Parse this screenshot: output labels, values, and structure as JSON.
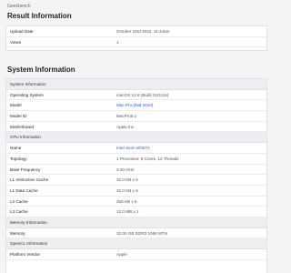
{
  "breadcrumb": "Geekbench",
  "result": {
    "title": "Result Information",
    "rows": [
      {
        "key": "Upload Date",
        "value": "October 23rd 2022, 11:44am"
      },
      {
        "key": "Views",
        "value": "1"
      }
    ]
  },
  "system": {
    "title": "System Information",
    "sections": [
      {
        "header": "System Information",
        "rows": [
          {
            "key": "Operating System",
            "value": "macOS 12.6 (Build 21G115)"
          },
          {
            "key": "Model",
            "value": "Mac Pro (Mid 2010)",
            "link": true
          },
          {
            "key": "Model ID",
            "value": "MacPro5,1"
          },
          {
            "key": "Motherboard",
            "value": "Apple Inc."
          }
        ]
      },
      {
        "header": "CPU Information",
        "rows": [
          {
            "key": "Name",
            "value": "Intel Xeon W3670",
            "link": true
          },
          {
            "key": "Topology",
            "value": "1 Processor, 6 Cores, 12 Threads"
          },
          {
            "key": "Base Frequency",
            "value": "3.20 GHz"
          },
          {
            "key": "L1 Instruction Cache",
            "value": "32.0 KB x 6"
          },
          {
            "key": "L1 Data Cache",
            "value": "32.0 KB x 6"
          },
          {
            "key": "L2 Cache",
            "value": "256 KB x 6"
          },
          {
            "key": "L3 Cache",
            "value": "12.0 MB x 1"
          }
        ]
      },
      {
        "header": "Memory Information",
        "rows": [
          {
            "key": "Memory",
            "value": "32.00 GB DDR3 1066 MT/s"
          }
        ]
      },
      {
        "header": "OpenCL Information",
        "rows": [
          {
            "key": "Platform Vendor",
            "value": "Apple"
          }
        ]
      }
    ]
  }
}
